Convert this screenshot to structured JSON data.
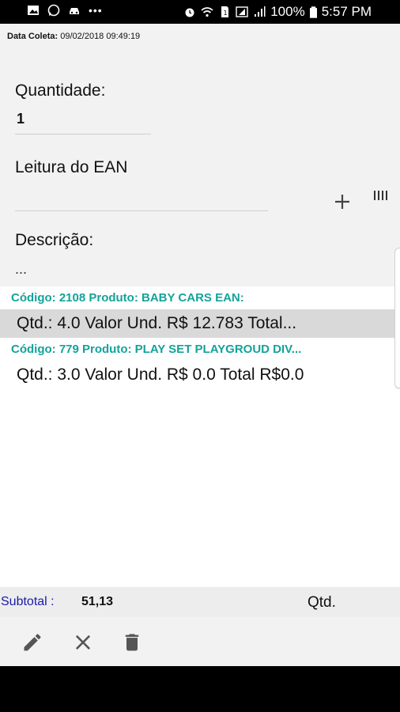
{
  "status_bar": {
    "battery": "100%",
    "time": "5:57 PM",
    "dots": "•••"
  },
  "header": {
    "data_coleta_label": "Data Coleta:",
    "data_coleta_value": "09/02/2018 09:49:19"
  },
  "form": {
    "quantidade_label": "Quantidade:",
    "quantidade_value": "1",
    "ean_label": "Leitura do EAN",
    "ean_value": "",
    "descricao_label": "Descrição:",
    "descricao_value": "..."
  },
  "items": [
    {
      "header": "Código: 2108  Produto:  BABY CARS EAN:",
      "details": "Qtd.: 4.0  Valor Und. R$ 12.783  Total..."
    },
    {
      "header": "Código: 779  Produto: PLAY SET PLAYGROUD DIV...",
      "details": "Qtd.: 3.0  Valor Und. R$ 0.0  Total R$0.0"
    }
  ],
  "footer": {
    "subtotal_label": "Subtotal :",
    "subtotal_value": "51,13",
    "qtd_label": "Qtd."
  },
  "colors": {
    "accent_teal": "#13a39a",
    "subtotal_blue": "#1a1aa8"
  },
  "icons": {
    "add": "plus-icon",
    "scan": "barcode-icon",
    "edit": "pencil-icon",
    "cancel": "close-icon",
    "delete": "trash-icon"
  }
}
